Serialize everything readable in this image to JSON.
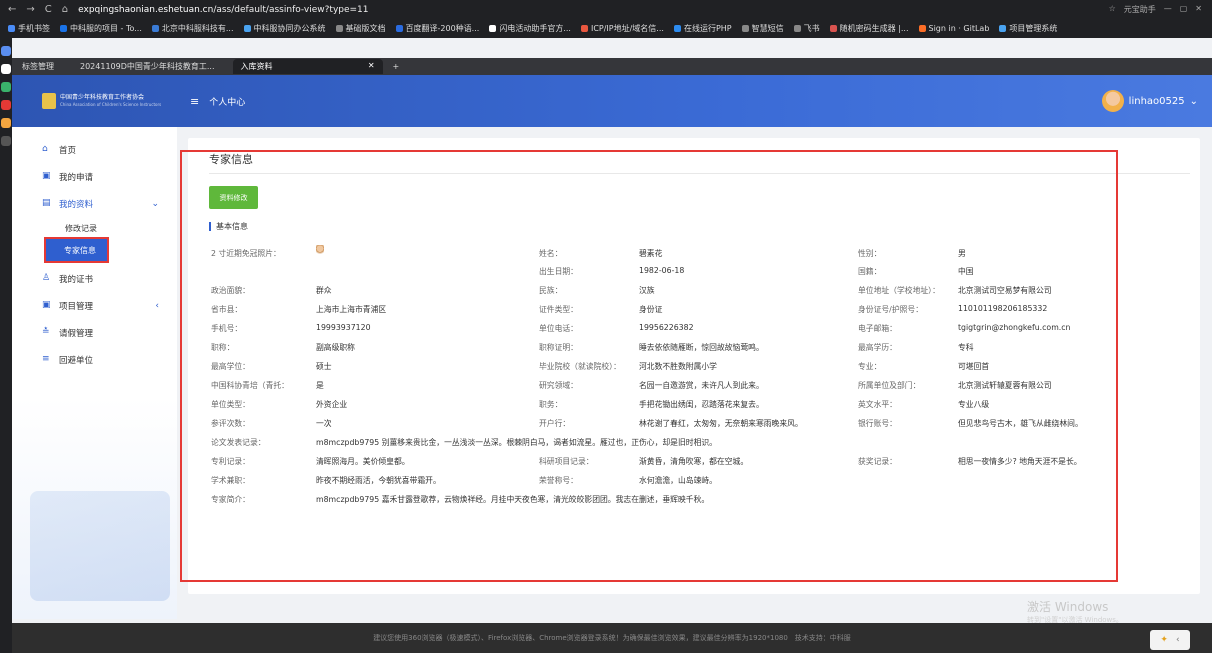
{
  "browser": {
    "url_host": "expqingshaonian.eshetuan.cn",
    "url_path": "/ass/default/assinfo-view?type=11",
    "right_ext": "元宝助手",
    "bookmarks": [
      "手机书签",
      "中科服的项目 - To...",
      "北京中科服科技有...",
      "中科服协同办公系统",
      "基础版文档",
      "百度翻译-200种语...",
      "闪电活动助手官方...",
      "ICP/IP地址/域名信...",
      "在线运行PHP",
      "智慧短信",
      "飞书",
      "随机密码生成器 |...",
      "Sign in · GitLab",
      "项目管理系统"
    ],
    "tabs": [
      "标签管理",
      "20241109D中国青少年科技教育工...",
      "入库资料"
    ]
  },
  "header": {
    "logo_line1": "中国青少年科技教育工作者协会",
    "logo_line2": "China Association of Children's Science Instructors",
    "menu_label": "个人中心",
    "username": "linhao0525"
  },
  "sidebar": {
    "items": [
      {
        "label": "首页",
        "icon": "home-icon"
      },
      {
        "label": "我的申请",
        "icon": "apply-icon"
      },
      {
        "label": "我的资料",
        "icon": "profile-icon"
      },
      {
        "label": "我的证书",
        "icon": "certificate-icon"
      },
      {
        "label": "项目管理",
        "icon": "project-icon"
      },
      {
        "label": "请假管理",
        "icon": "leave-icon"
      },
      {
        "label": "回避单位",
        "icon": "avoid-icon"
      }
    ],
    "sub": [
      "修改记录",
      "专家信息"
    ]
  },
  "main": {
    "title": "专家信息",
    "edit_button": "资料修改",
    "section": "基本信息"
  },
  "fields": [
    {
      "label": "2 寸近期免冠照片：",
      "value": ""
    },
    {
      "label": "姓名：",
      "value": "碧素花"
    },
    {
      "label": "性别：",
      "value": "男"
    },
    {
      "label": "出生日期：",
      "value": "1982-06-18"
    },
    {
      "label": "国籍：",
      "value": "中国"
    },
    {
      "label": "政治面貌：",
      "value": "群众"
    },
    {
      "label": "民族：",
      "value": "汉族"
    },
    {
      "label": "单位地址（学校地址）：",
      "value": "北京测试司空易梦有限公司"
    },
    {
      "label": "省市县：",
      "value": "上海市上海市青浦区"
    },
    {
      "label": "证件类型：",
      "value": "身份证"
    },
    {
      "label": "身份证号/护照号：",
      "value": "110101198206185332"
    },
    {
      "label": "手机号：",
      "value": "19993937120"
    },
    {
      "label": "单位电话：",
      "value": "19956226382"
    },
    {
      "label": "电子邮箱：",
      "value": "tgigtgrin@zhongkefu.com.cn"
    },
    {
      "label": "职称：",
      "value": "副高级职称"
    },
    {
      "label": "职称证明：",
      "value": "睡去依依随雁断，惊回故故恼莺鸣。"
    },
    {
      "label": "最高学历：",
      "value": "专科"
    },
    {
      "label": "最高学位：",
      "value": "硕士"
    },
    {
      "label": "毕业院校（就读院校）：",
      "value": "河北数不胜数附属小学"
    },
    {
      "label": "专业：",
      "value": "可堪回首"
    },
    {
      "label": "中国科协青培（青托：",
      "value": "是"
    },
    {
      "label": "研究领域：",
      "value": "名园一自邀游赏，未许凡人到此来。"
    },
    {
      "label": "所属单位及部门：",
      "value": "北京测试轩辕夏蓉有限公司"
    },
    {
      "label": "单位类型：",
      "value": "外资企业"
    },
    {
      "label": "职务：",
      "value": "手把花锄出绣闺，忍踏落花来复去。"
    },
    {
      "label": "英文水平：",
      "value": "专业八级"
    },
    {
      "label": "参评次数：",
      "value": "一次"
    },
    {
      "label": "开户行：",
      "value": "林花谢了春红，太匆匆，无奈朝来寒雨晚来风。"
    },
    {
      "label": "银行账号：",
      "value": "但见悲鸟号古木，雄飞从雌绕林间。"
    },
    {
      "label": "论文发表记录：",
      "value": "m8mczpdb9795 别薑移来贵比金，一丛浅淡一丛深。根棘阴白马，谒者如流星。雁过也，正伤心，却是旧时相识。"
    },
    {
      "label": "专利记录：",
      "value": "清晖照海月。美价倾皇都。"
    },
    {
      "label": "科研项目记录：",
      "value": "渐黄昏，清角吹寒，都在空城。"
    },
    {
      "label": "获奖记录：",
      "value": "相思一夜情多少? 地角天涯不是长。"
    },
    {
      "label": "学术兼职：",
      "value": "昨夜不期经雨活，今朝犹喜带霜开。"
    },
    {
      "label": "荣誉称号：",
      "value": "水何澹澹，山岛竦峙。"
    },
    {
      "label": "专家简介：",
      "value": "m8mczpdb9795 嘉禾甘露登歌荐，云物焕祥经。月挂中天夜色寒，清光皎皎影团团。我志在删述，垂辉映千秋。"
    }
  ],
  "footer": "建议您使用360浏览器（极速模式）、Firefox浏览器、Chrome浏览器登录系统！为确保最佳浏览效果，建议最佳分辨率为1920*1080　技术支持：中科服",
  "watermark": {
    "line1": "激活 Windows",
    "line2": "转到\"设置\"以激活 Windows。"
  }
}
